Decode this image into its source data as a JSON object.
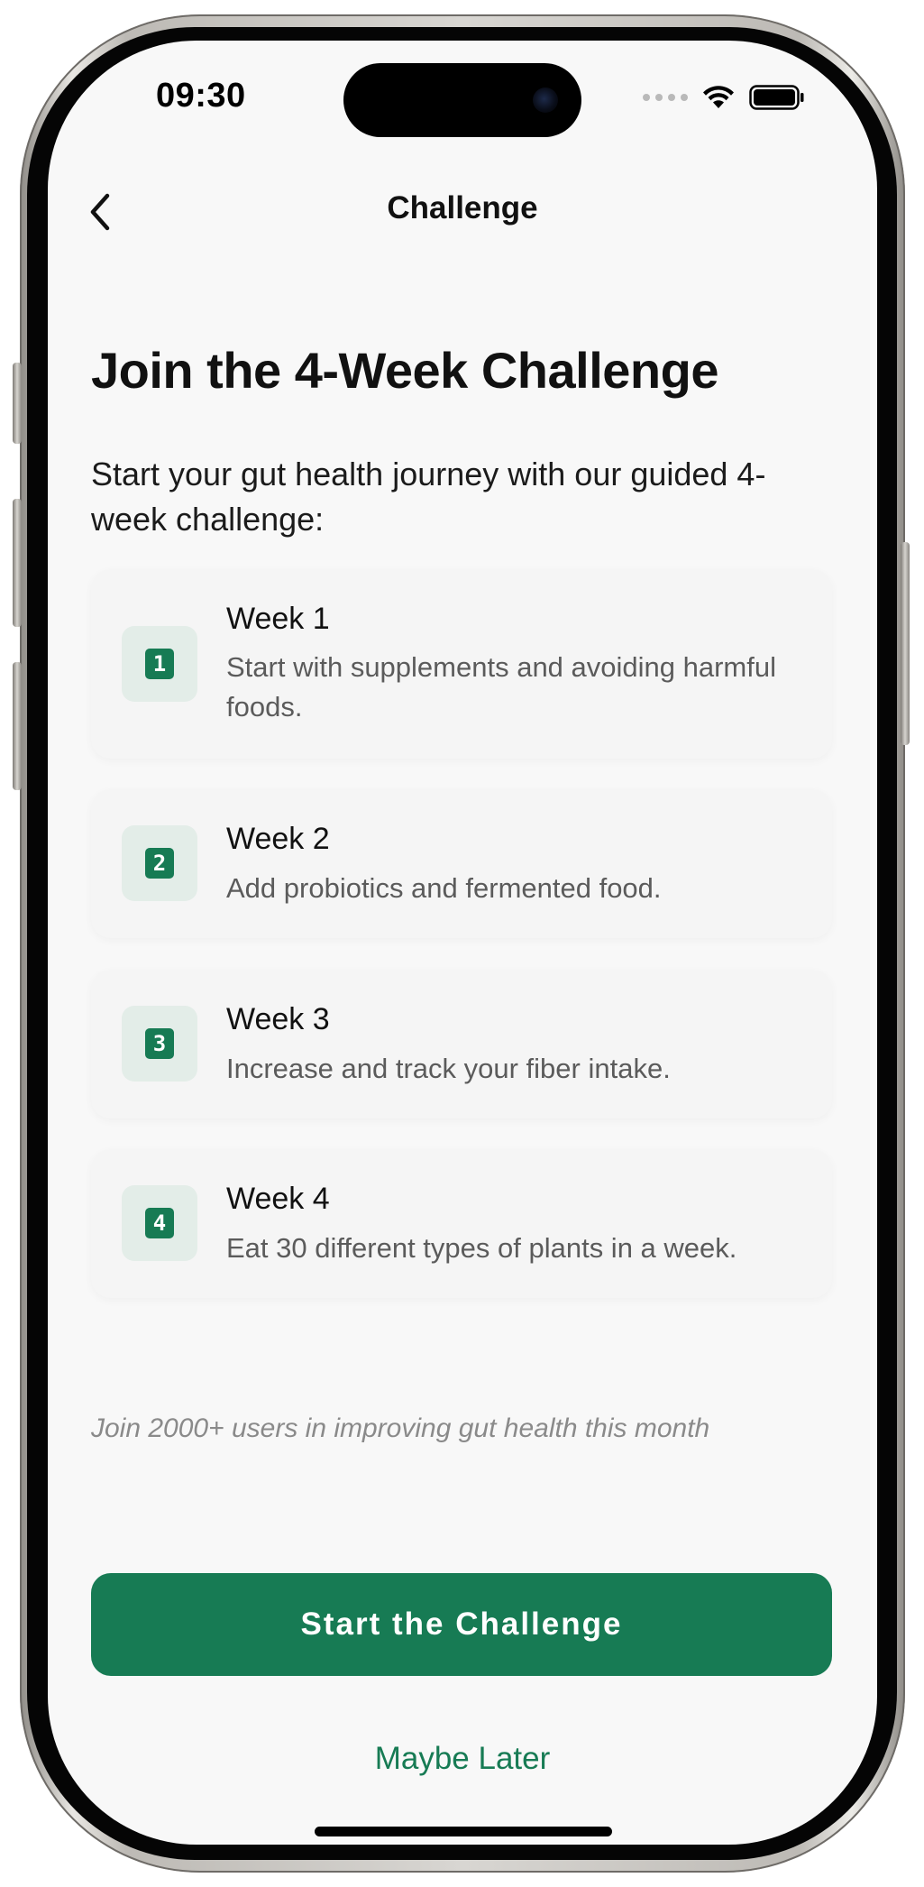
{
  "status_bar": {
    "time": "09:30",
    "icons": [
      "cellular-dots-icon",
      "wifi-icon",
      "battery-icon"
    ]
  },
  "nav": {
    "back_icon": "chevron-left-icon",
    "title": "Challenge"
  },
  "headline": "Join the 4-Week Challenge",
  "intro": "Start your gut health journey with our guided 4-week challenge:",
  "weeks": [
    {
      "number": "1",
      "title": "Week 1",
      "description": "Start with supplements and avoiding harmful foods."
    },
    {
      "number": "2",
      "title": "Week 2",
      "description": "Add probiotics and fermented food."
    },
    {
      "number": "3",
      "title": "Week 3",
      "description": "Increase and track your fiber intake."
    },
    {
      "number": "4",
      "title": "Week 4",
      "description": "Eat 30 different types of plants in a week."
    }
  ],
  "social_proof": "Join 2000+ users in improving gut health this month",
  "actions": {
    "primary": "Start the Challenge",
    "secondary": "Maybe Later"
  },
  "colors": {
    "accent": "#177b54",
    "icon_bg": "#e3ede8",
    "screen_bg": "#f8f8f8",
    "card_bg": "#f5f5f5"
  }
}
